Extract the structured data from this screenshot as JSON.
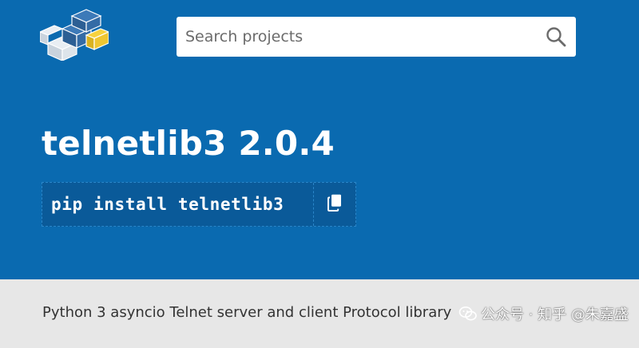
{
  "header": {
    "search": {
      "placeholder": "Search projects",
      "value": ""
    }
  },
  "package": {
    "title": "telnetlib3 2.0.4",
    "install_command": "pip install telnetlib3",
    "summary": "Python 3 asyncio Telnet server and client Protocol library"
  },
  "watermark": {
    "text": "公众号 · 知乎 @朱嘉盛"
  },
  "colors": {
    "header_bg": "#0a6ab0",
    "pip_bg": "#0a5a99",
    "description_bg": "#e7e7e7",
    "logo_yellow": "#f7d23e",
    "logo_blue": "#3d7ab8",
    "text_dark": "#333333"
  },
  "icons": {
    "logo": "pypi-logo-icon",
    "search": "search-icon",
    "copy": "copy-icon",
    "watermark": "wechat-icon"
  }
}
